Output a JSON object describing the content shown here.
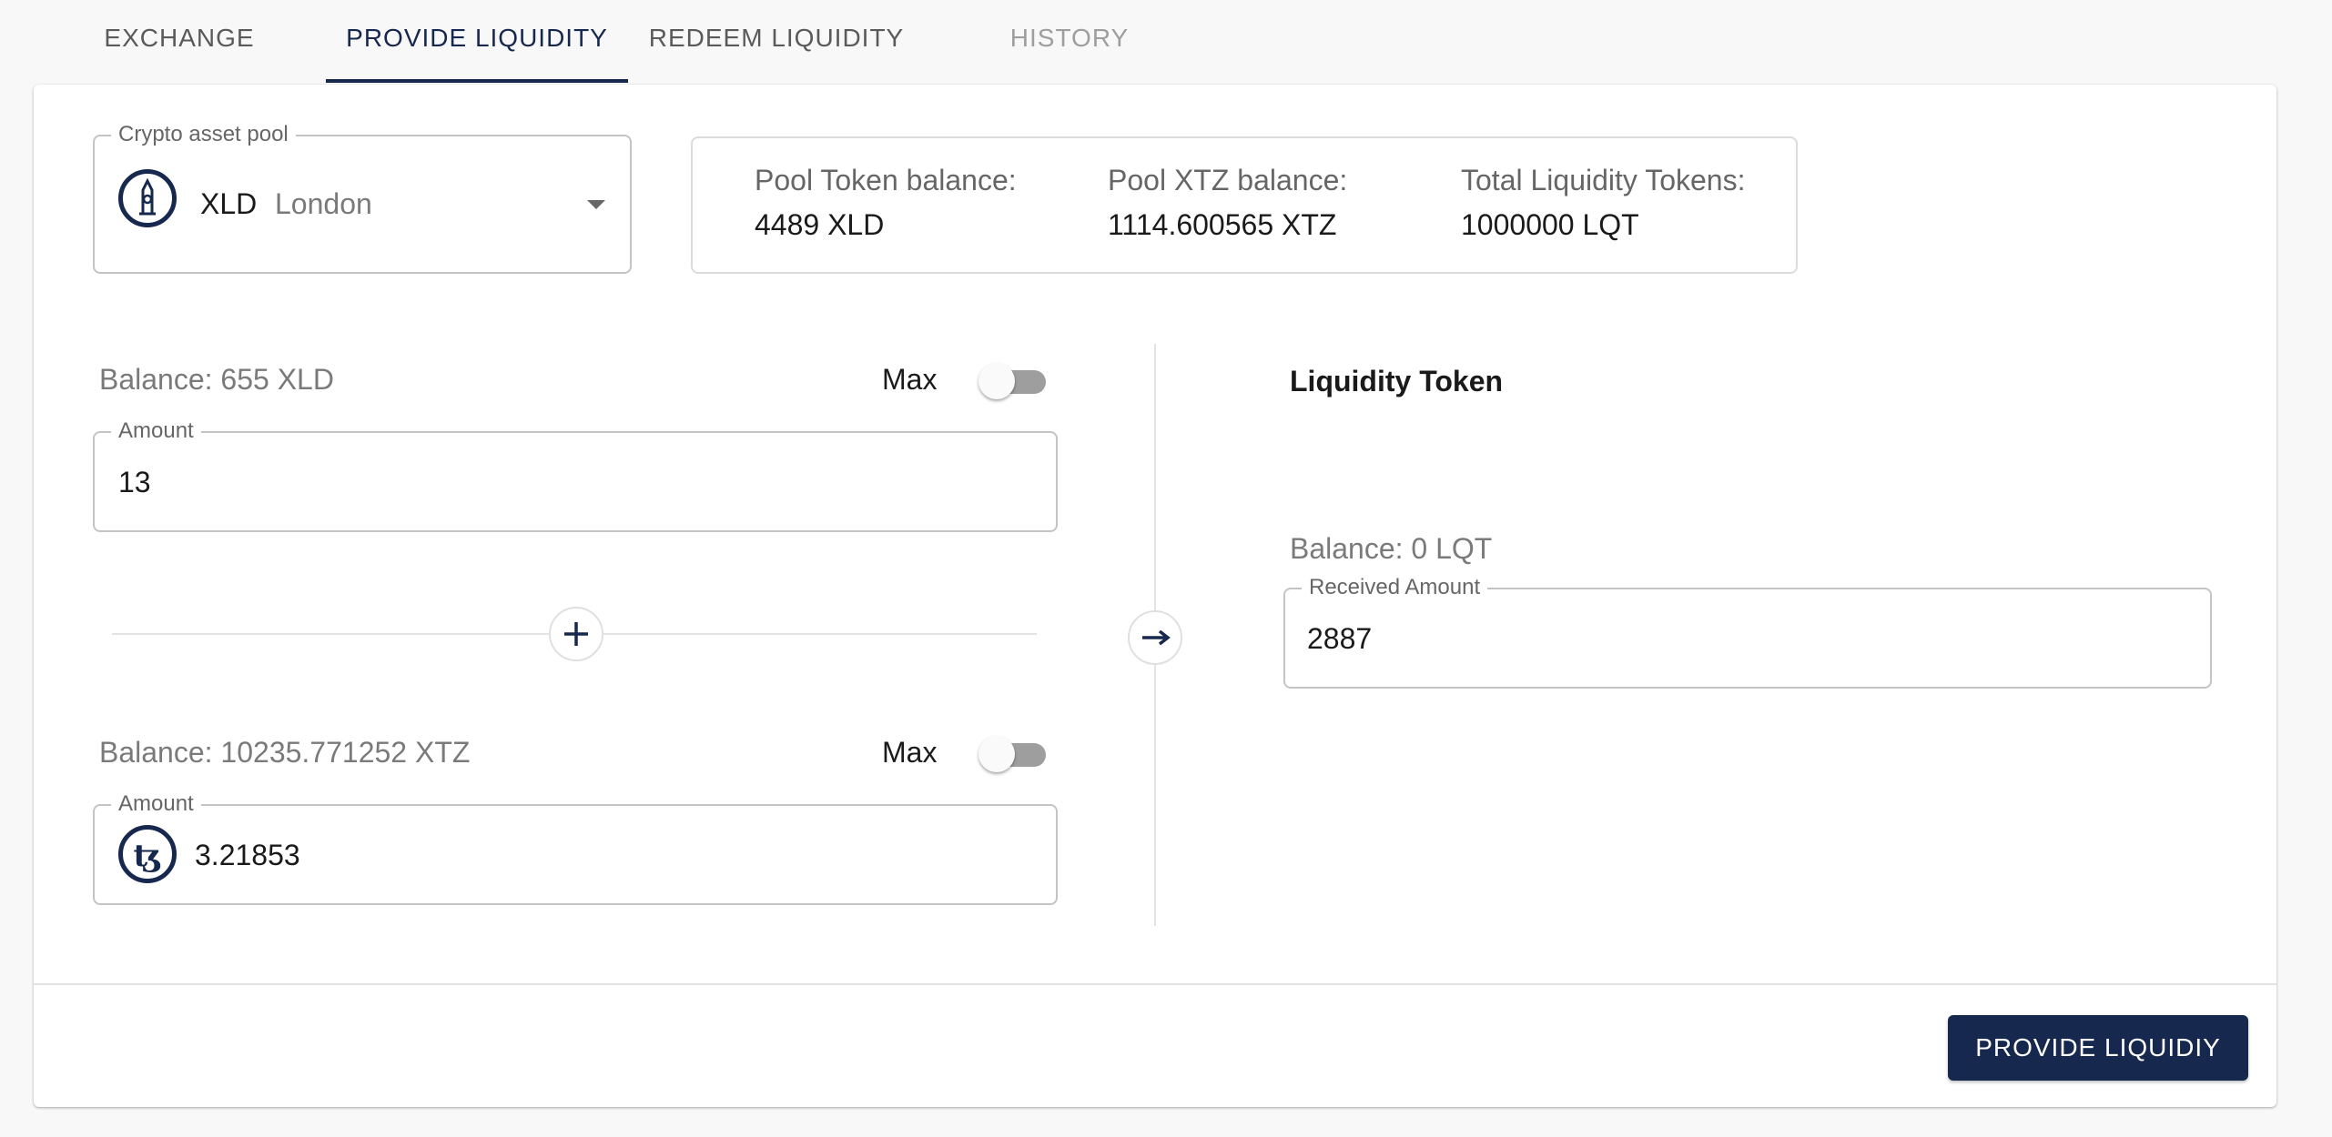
{
  "tabs": [
    {
      "label": "EXCHANGE",
      "state": "normal"
    },
    {
      "label": "PROVIDE LIQUIDITY",
      "state": "active"
    },
    {
      "label": "REDEEM LIQUIDITY",
      "state": "normal"
    },
    {
      "label": "HISTORY",
      "state": "disabled"
    }
  ],
  "pool_select": {
    "legend": "Crypto asset pool",
    "symbol": "XLD",
    "name": "London",
    "icon": "big-ben-icon"
  },
  "pool_info": {
    "token_balance_label": "Pool Token balance:",
    "token_balance_value": "4489 XLD",
    "xtz_balance_label": "Pool XTZ balance:",
    "xtz_balance_value": "1114.600565 XTZ",
    "total_lqt_label": "Total Liquidity Tokens:",
    "total_lqt_value": "1000000 LQT"
  },
  "token_input": {
    "balance": "Balance: 655 XLD",
    "max_label": "Max",
    "max_enabled": false,
    "legend": "Amount",
    "value": "13"
  },
  "xtz_input": {
    "balance": "Balance: 10235.771252 XTZ",
    "max_label": "Max",
    "max_enabled": false,
    "legend": "Amount",
    "value": "3.21853",
    "icon": "tezos-icon"
  },
  "liquidity_output": {
    "title": "Liquidity Token",
    "balance": "Balance: 0 LQT",
    "legend": "Received Amount",
    "value": "2887"
  },
  "actions": {
    "submit_label": "PROVIDE LIQUIDIY"
  },
  "colors": {
    "primary": "#17284f",
    "background": "#f8f8f8",
    "toggle_off": "#9e9e9e"
  }
}
